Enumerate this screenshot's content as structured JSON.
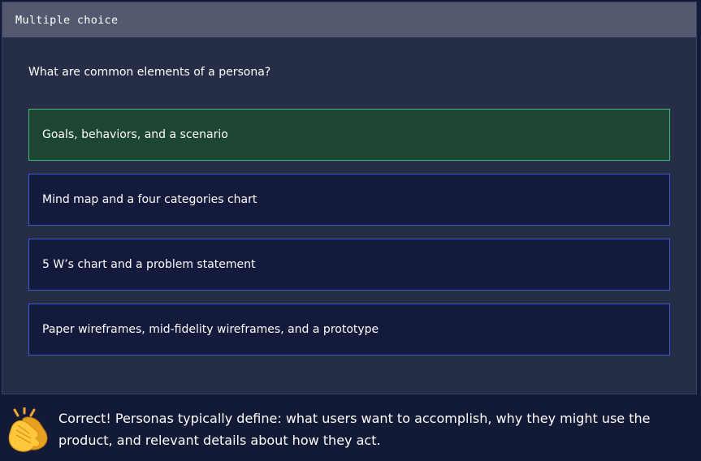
{
  "quiz": {
    "type_label": "Multiple choice",
    "question": "What are common elements of a persona?",
    "options": [
      {
        "label": "Goals, behaviors, and a scenario",
        "state": "correct"
      },
      {
        "label": "Mind map and a four categories chart",
        "state": "default"
      },
      {
        "label": "5 W’s chart and a problem statement",
        "state": "default"
      },
      {
        "label": "Paper wireframes, mid-fidelity wireframes, and a prototype",
        "state": "default"
      }
    ]
  },
  "feedback": {
    "icon": "clapping-hands-icon",
    "text": "Correct! Personas typically define: what users want to accomplish, why they might use the product, and relevant details about how they act."
  },
  "colors": {
    "background": "#131a35",
    "card": "#262d47",
    "header": "#535a70",
    "option_bg": "#141a3c",
    "option_border": "#3f5bd6",
    "correct_bg": "#1c4532",
    "correct_border": "#3fb87a"
  }
}
